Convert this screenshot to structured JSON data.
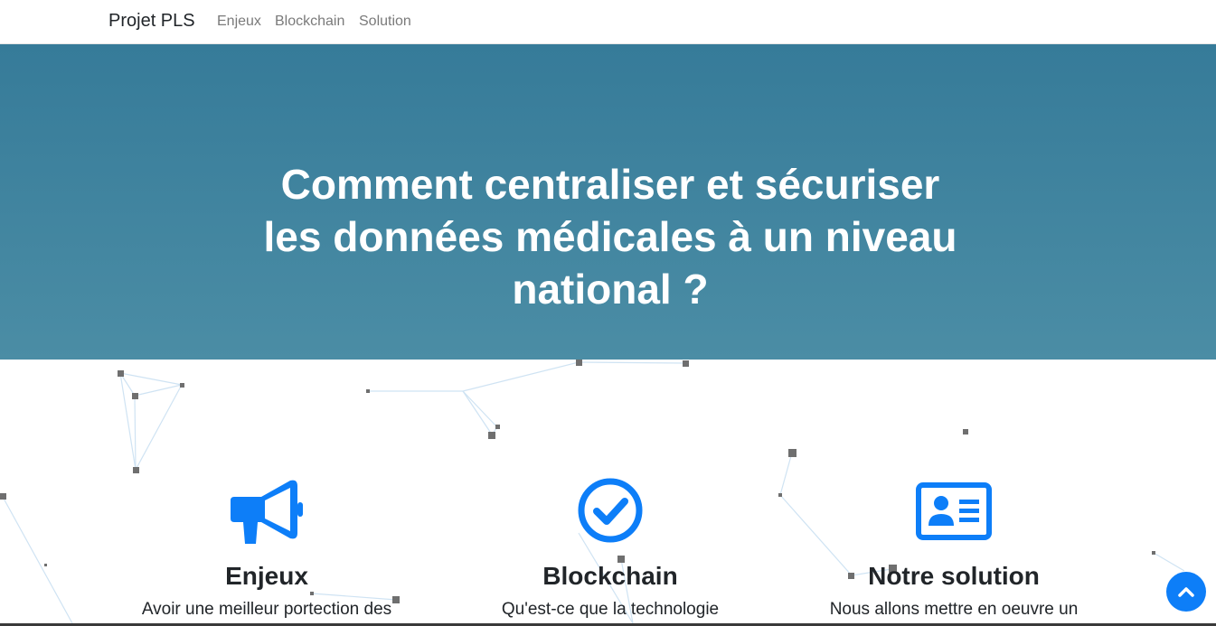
{
  "nav": {
    "brand": "Projet PLS",
    "links": [
      "Enjeux",
      "Blockchain",
      "Solution"
    ]
  },
  "hero": {
    "title_lines": [
      "Comment centraliser et sécuriser",
      "les données médicales à un niveau",
      "national ?"
    ]
  },
  "features": [
    {
      "icon": "megaphone-icon",
      "title": "Enjeux",
      "text": "Avoir une meilleur portection des"
    },
    {
      "icon": "check-circle-icon",
      "title": "Blockchain",
      "text": "Qu'est-ce que la technologie"
    },
    {
      "icon": "id-card-icon",
      "title": "Notre solution",
      "text": "Nous allons mettre en oeuvre un"
    }
  ],
  "scroll_top": {
    "icon": "chevron-up-icon"
  },
  "colors": {
    "hero_top": "#367b99",
    "hero_bottom": "#4b8da5",
    "accent": "#0d7ef8"
  }
}
